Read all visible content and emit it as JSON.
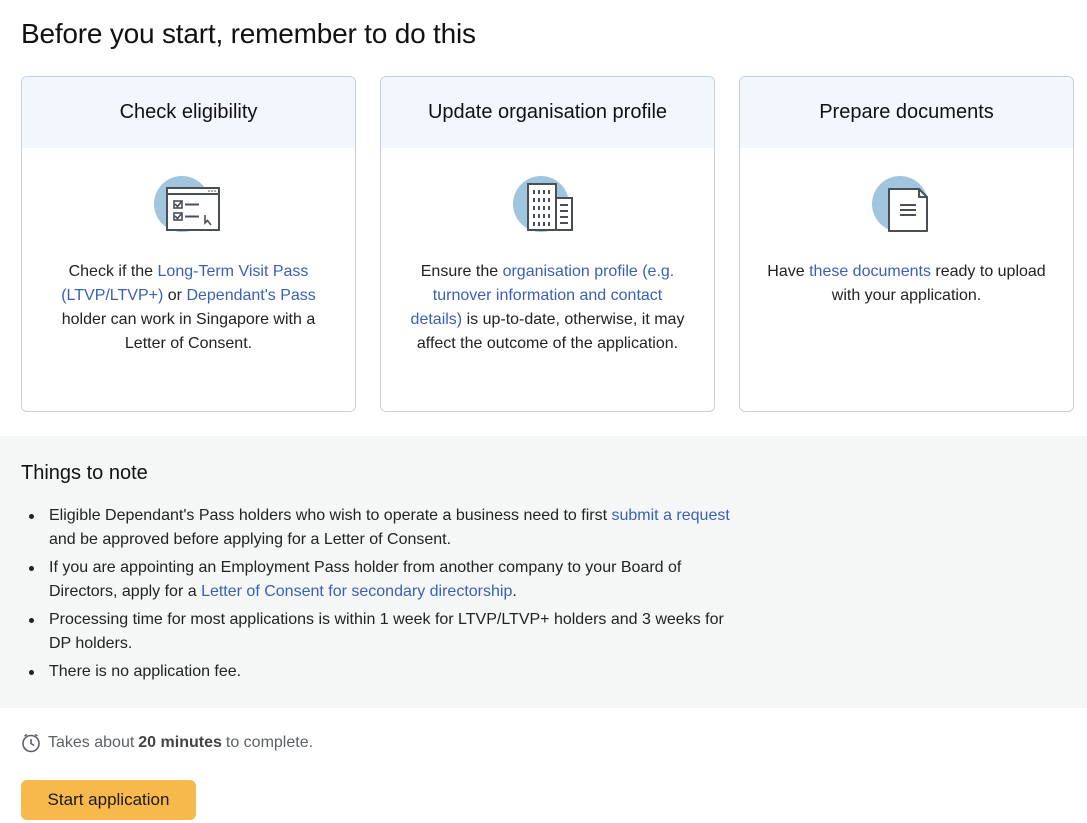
{
  "page": {
    "title": "Before you start, remember to do this"
  },
  "cards": [
    {
      "title": "Check eligibility",
      "icon": "checklist-icon",
      "text_1": "Check if the ",
      "link_1": "Long-Term Visit Pass (LTVP/LTVP+)",
      "text_2": " or ",
      "link_2": "Dependant's Pass",
      "text_3": " holder can work in Singapore with a Letter of Consent."
    },
    {
      "title": "Update organisation profile",
      "icon": "building-icon",
      "text_1": "Ensure the ",
      "link_1": "organisation profile (e.g. turnover information and contact details)",
      "text_2": " is up-to-date, otherwise, it may affect the outcome of the application."
    },
    {
      "title": "Prepare documents",
      "icon": "document-icon",
      "text_1": "Have ",
      "link_1": "these documents",
      "text_2": " ready to upload with your application."
    }
  ],
  "notes": {
    "title": "Things to note",
    "items": [
      {
        "text_1": "Eligible Dependant's Pass holders who wish to operate a business need to first ",
        "link": "submit a request",
        "text_2": " and be approved before applying for a Letter of Consent."
      },
      {
        "text_1": "If you are appointing an Employment Pass holder from another company to your Board of Directors, apply for a ",
        "link": "Letter of Consent for secondary directorship",
        "text_2": "."
      },
      {
        "text_1": "Processing time for most applications is within 1 week for LTVP/LTVP+ holders and 3 weeks for DP holders."
      },
      {
        "text_1": "There is no application fee."
      }
    ]
  },
  "footer": {
    "time_prefix": "Takes about",
    "time_value": "20 minutes",
    "time_suffix": "to complete.",
    "start_label": "Start application"
  },
  "colors": {
    "accent_button": "#f7b84c",
    "link": "#3a5fb5",
    "icon_circle": "#9fc6de",
    "card_header_bg": "#f1f7fd",
    "notes_bg": "#f4f7f6"
  }
}
